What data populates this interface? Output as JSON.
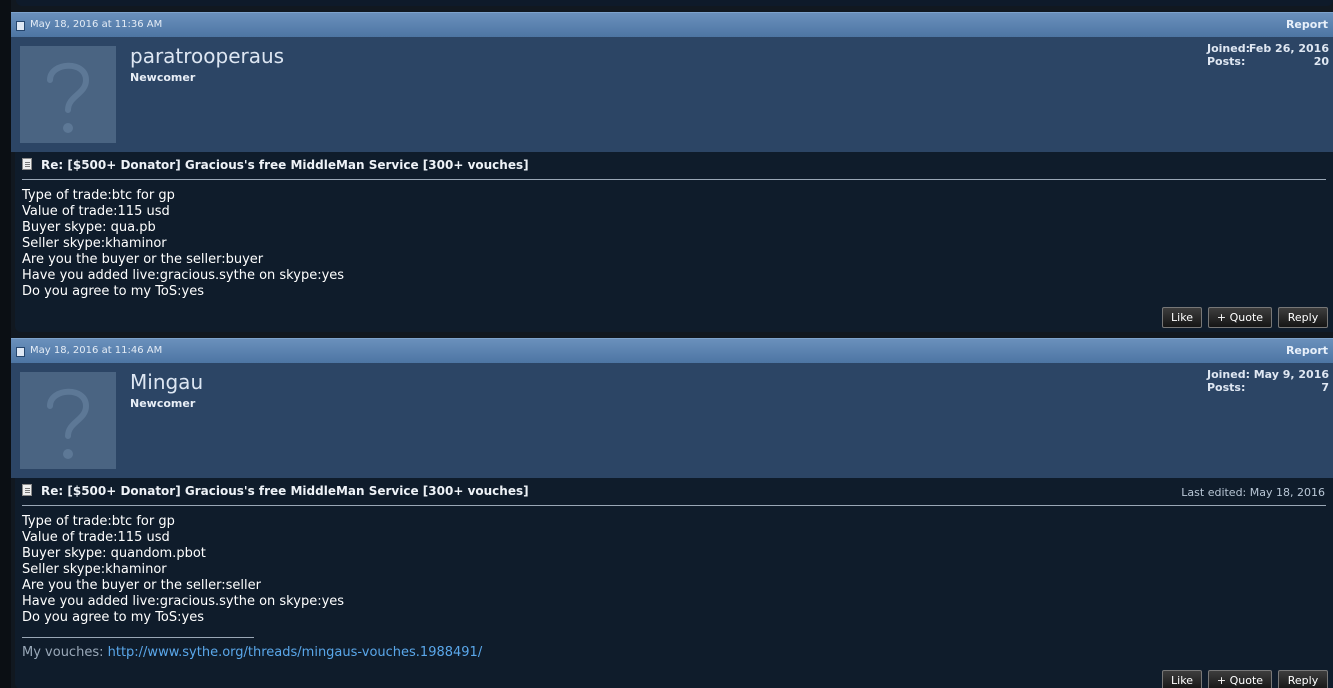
{
  "posts": [
    {
      "date": "May 18, 2016 at 11:36 AM",
      "report_label": "Report",
      "username": "paratrooperaus",
      "user_title": "Newcomer",
      "joined_label": "Joined:",
      "joined_value": "Feb 26, 2016",
      "posts_label": "Posts:",
      "posts_value": "20",
      "title": "Re: [$500+ Donator] Gracious's free MiddleMan Service [300+ vouches]",
      "last_edited": "",
      "lines": [
        "Type of trade:btc for gp",
        "Value of trade:115 usd",
        "Buyer skype: qua.pb",
        "Seller skype:khaminor",
        "Are you the buyer or the seller:buyer",
        "Have you added live:gracious.sythe on skype:yes",
        "Do you agree to my ToS:yes"
      ],
      "signature_label": "",
      "signature_link": "",
      "like_label": "Like",
      "quote_label": "+ Quote",
      "reply_label": "Reply"
    },
    {
      "date": "May 18, 2016 at 11:46 AM",
      "report_label": "Report",
      "username": "Mingau",
      "user_title": "Newcomer",
      "joined_label": "Joined:",
      "joined_value": "May 9, 2016",
      "posts_label": "Posts:",
      "posts_value": "7",
      "title": "Re: [$500+ Donator] Gracious's free MiddleMan Service [300+ vouches]",
      "last_edited": "Last edited: May 18, 2016",
      "lines": [
        "Type of trade:btc for gp",
        "Value of trade:115 usd",
        "Buyer skype: quandom.pbot",
        "Seller skype:khaminor",
        "Are you the buyer or the seller:seller",
        "Have you added live:gracious.sythe on skype:yes",
        "Do you agree to my ToS:yes"
      ],
      "signature_label": "My vouches:",
      "signature_link": "http://www.sythe.org/threads/mingaus-vouches.1988491/",
      "like_label": "Like",
      "quote_label": "+ Quote",
      "reply_label": "Reply"
    }
  ]
}
